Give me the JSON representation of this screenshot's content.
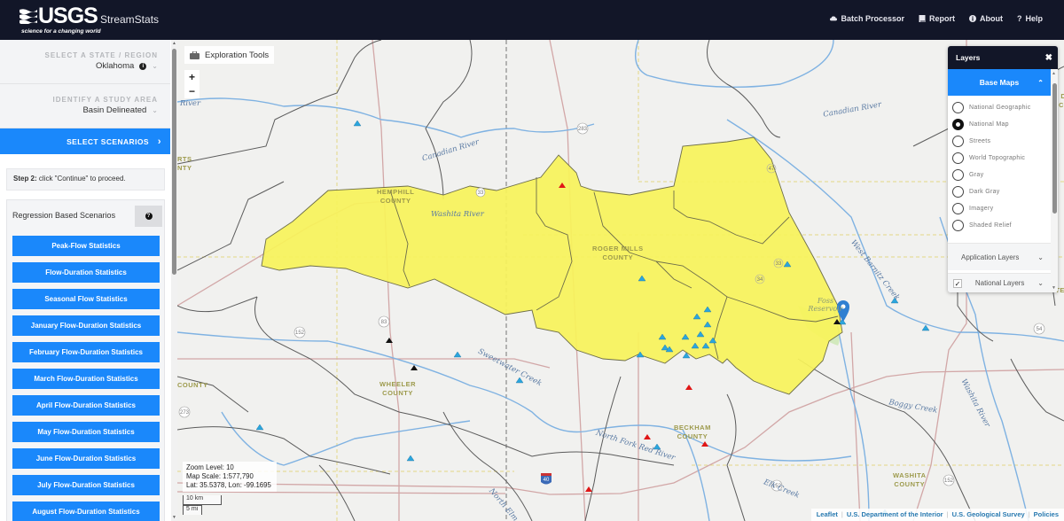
{
  "header": {
    "logo_text": "USGS",
    "logo_tagline": "science for a changing world",
    "app_name": "StreamStats",
    "nav": [
      {
        "label": "Batch Processor",
        "icon": "cloud-icon"
      },
      {
        "label": "Report",
        "icon": "book-icon"
      },
      {
        "label": "About",
        "icon": "info-icon"
      },
      {
        "label": "Help",
        "icon": "question-icon"
      }
    ]
  },
  "sidebar": {
    "state": {
      "label": "SELECT A STATE / REGION",
      "value": "Oklahoma"
    },
    "study_area": {
      "label": "IDENTIFY A STUDY AREA",
      "value": "Basin Delineated"
    },
    "select_scenarios": "SELECT SCENARIOS",
    "step": {
      "bold": "Step 2:",
      "text": " click \"Continue\" to proceed."
    },
    "scenarios_title": "Regression Based Scenarios",
    "scenario_buttons": [
      "Peak-Flow Statistics",
      "Flow-Duration Statistics",
      "Seasonal Flow Statistics",
      "January Flow-Duration Statistics",
      "February Flow-Duration Statistics",
      "March Flow-Duration Statistics",
      "April Flow-Duration Statistics",
      "May Flow-Duration Statistics",
      "June Flow-Duration Statistics",
      "July Flow-Duration Statistics",
      "August Flow-Duration Statistics"
    ]
  },
  "map": {
    "exploration_tools": "Exploration Tools",
    "zoom_in": "+",
    "zoom_out": "−",
    "readout": {
      "zoom_level": "Zoom Level: 10",
      "map_scale": "Map Scale: 1:577,790",
      "lat_lon": "Lat: 35.5378, Lon: -99.1695"
    },
    "scale_km": "10 km",
    "scale_mi": "5 mi",
    "attribution": [
      "Leaflet",
      "U.S. Department of the Interior",
      "U.S. Geological Survey",
      "Policies"
    ],
    "labels": {
      "hemphill": [
        "HEMPHILL",
        "COUNTY"
      ],
      "roger_mills": [
        "ROGER MILLS",
        "COUNTY"
      ],
      "wheeler": [
        "WHEELER",
        "COUNTY"
      ],
      "beckham": [
        "BECKHAM",
        "COUNTY"
      ],
      "washita": [
        "WASHITA",
        "COUNTY"
      ],
      "dewey": "DEWEY COUNTY",
      "custer": "CUSTER",
      "roberts": [
        "RTS",
        "NTY"
      ],
      "left_county": "COUNTY",
      "canadian_river_1": "Canadian River",
      "canadian_river_2": "Canadian River",
      "washita_river": "Washita River",
      "sweetwater_creek": "Sweetwater Creek",
      "north_fork": "North Fork Red River",
      "west_barnitz": "West Barnitz Creek",
      "boggy_creek": "Boggy Creek",
      "washita_river_2": "Washita River",
      "elk_creek": "Elk Creek",
      "foss_reservoir": "Foss Reservoir",
      "river_left": "River",
      "north_elm": "North Elm"
    },
    "route_shields": [
      "283",
      "33",
      "47",
      "33",
      "34",
      "83",
      "152",
      "152",
      "183",
      "54",
      "40",
      "273",
      "152"
    ]
  },
  "layers_panel": {
    "title": "Layers",
    "base_maps": "Base Maps",
    "base_map_options": [
      {
        "label": "National Geographic",
        "selected": false
      },
      {
        "label": "National Map",
        "selected": true
      },
      {
        "label": "Streets",
        "selected": false
      },
      {
        "label": "World Topographic",
        "selected": false
      },
      {
        "label": "Gray",
        "selected": false
      },
      {
        "label": "Dark Gray",
        "selected": false
      },
      {
        "label": "Imagery",
        "selected": false
      },
      {
        "label": "Shaded Relief",
        "selected": false
      }
    ],
    "application_layers": "Application Layers",
    "national_layers": "National Layers",
    "national_layers_checked": true
  },
  "colors": {
    "header_bg": "#121628",
    "accent_blue": "#1a88fb",
    "basin_yellow": "#f7f35a",
    "gage_blue": "#2ba6de",
    "gage_red": "#e01616",
    "gage_black": "#111111"
  }
}
